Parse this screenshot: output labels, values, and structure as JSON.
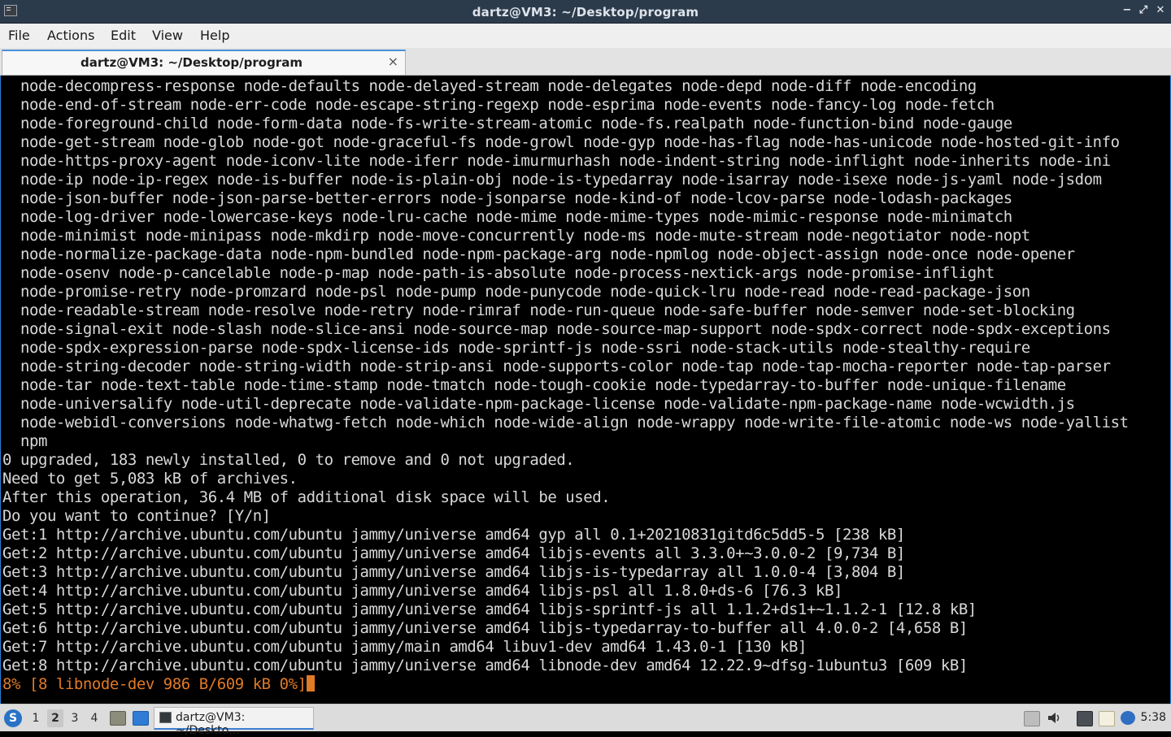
{
  "window": {
    "title": "dartz@VM3: ~/Desktop/program",
    "minimize_glyph": "−",
    "maximize_glyph": "⤢",
    "close_glyph": "✕"
  },
  "menu": {
    "file": "File",
    "actions": "Actions",
    "edit": "Edit",
    "view": "View",
    "help": "Help"
  },
  "tab": {
    "label": "dartz@VM3: ~/Desktop/program",
    "close_glyph": "×"
  },
  "terminal": {
    "lines": [
      "  node-decompress-response node-defaults node-delayed-stream node-delegates node-depd node-diff node-encoding",
      "  node-end-of-stream node-err-code node-escape-string-regexp node-esprima node-events node-fancy-log node-fetch",
      "  node-foreground-child node-form-data node-fs-write-stream-atomic node-fs.realpath node-function-bind node-gauge",
      "  node-get-stream node-glob node-got node-graceful-fs node-growl node-gyp node-has-flag node-has-unicode node-hosted-git-info",
      "  node-https-proxy-agent node-iconv-lite node-iferr node-imurmurhash node-indent-string node-inflight node-inherits node-ini",
      "  node-ip node-ip-regex node-is-buffer node-is-plain-obj node-is-typedarray node-isarray node-isexe node-js-yaml node-jsdom",
      "  node-json-buffer node-json-parse-better-errors node-jsonparse node-kind-of node-lcov-parse node-lodash-packages",
      "  node-log-driver node-lowercase-keys node-lru-cache node-mime node-mime-types node-mimic-response node-minimatch",
      "  node-minimist node-minipass node-mkdirp node-move-concurrently node-ms node-mute-stream node-negotiator node-nopt",
      "  node-normalize-package-data node-npm-bundled node-npm-package-arg node-npmlog node-object-assign node-once node-opener",
      "  node-osenv node-p-cancelable node-p-map node-path-is-absolute node-process-nextick-args node-promise-inflight",
      "  node-promise-retry node-promzard node-psl node-pump node-punycode node-quick-lru node-read node-read-package-json",
      "  node-readable-stream node-resolve node-retry node-rimraf node-run-queue node-safe-buffer node-semver node-set-blocking",
      "  node-signal-exit node-slash node-slice-ansi node-source-map node-source-map-support node-spdx-correct node-spdx-exceptions",
      "  node-spdx-expression-parse node-spdx-license-ids node-sprintf-js node-ssri node-stack-utils node-stealthy-require",
      "  node-string-decoder node-string-width node-strip-ansi node-supports-color node-tap node-tap-mocha-reporter node-tap-parser",
      "  node-tar node-text-table node-time-stamp node-tmatch node-tough-cookie node-typedarray-to-buffer node-unique-filename",
      "  node-universalify node-util-deprecate node-validate-npm-package-license node-validate-npm-package-name node-wcwidth.js",
      "  node-webidl-conversions node-whatwg-fetch node-which node-wide-align node-wrappy node-write-file-atomic node-ws node-yallist",
      "  npm",
      "0 upgraded, 183 newly installed, 0 to remove and 0 not upgraded.",
      "Need to get 5,083 kB of archives.",
      "After this operation, 36.4 MB of additional disk space will be used.",
      "Do you want to continue? [Y/n]",
      "Get:1 http://archive.ubuntu.com/ubuntu jammy/universe amd64 gyp all 0.1+20210831gitd6c5dd5-5 [238 kB]",
      "Get:2 http://archive.ubuntu.com/ubuntu jammy/universe amd64 libjs-events all 3.3.0+~3.0.0-2 [9,734 B]",
      "Get:3 http://archive.ubuntu.com/ubuntu jammy/universe amd64 libjs-is-typedarray all 1.0.0-4 [3,804 B]",
      "Get:4 http://archive.ubuntu.com/ubuntu jammy/universe amd64 libjs-psl all 1.8.0+ds-6 [76.3 kB]",
      "Get:5 http://archive.ubuntu.com/ubuntu jammy/universe amd64 libjs-sprintf-js all 1.1.2+ds1+~1.1.2-1 [12.8 kB]",
      "Get:6 http://archive.ubuntu.com/ubuntu jammy/universe amd64 libjs-typedarray-to-buffer all 4.0.0-2 [4,658 B]",
      "Get:7 http://archive.ubuntu.com/ubuntu jammy/main amd64 libuv1-dev amd64 1.43.0-1 [130 kB]",
      "Get:8 http://archive.ubuntu.com/ubuntu jammy/universe amd64 libnode-dev amd64 12.22.9~dfsg-1ubuntu3 [609 kB]"
    ],
    "progress_line": "8% [8 libnode-dev 986 B/609 kB 0%]",
    "progress_color": "#e07a26"
  },
  "taskbar": {
    "workspaces": [
      "1",
      "2",
      "3",
      "4"
    ],
    "active_workspace": "2",
    "task_label": "dartz@VM3: ~/Deskto…",
    "clock": "5:38",
    "icons": {
      "start": "lubuntu-logo-icon",
      "file_manager": "folder-icon",
      "desktop": "show-desktop-icon",
      "tray": [
        "tray-app-icon",
        "volume-icon",
        "network-icon",
        "clipboard-icon",
        "notification-icon"
      ]
    }
  }
}
